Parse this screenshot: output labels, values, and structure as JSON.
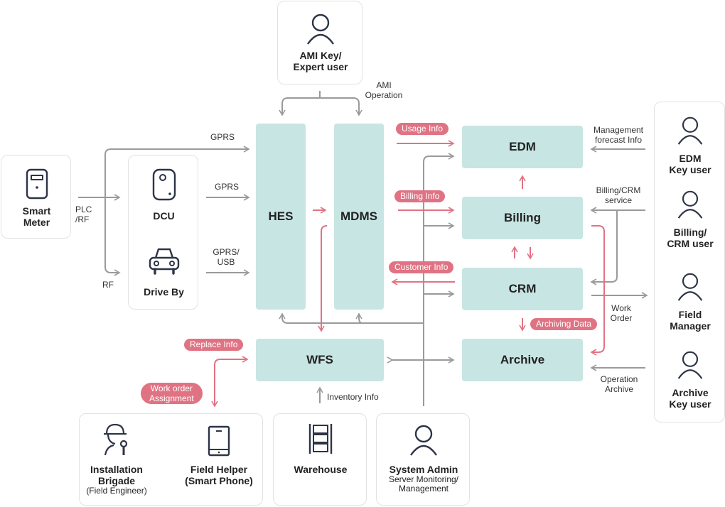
{
  "actors": {
    "ami_user": {
      "line1": "AMI Key/",
      "line2": "Expert user"
    },
    "smart_meter": {
      "line1": "Smart",
      "line2": "Meter"
    },
    "dcu": {
      "label": "DCU"
    },
    "drive_by": {
      "label": "Drive By"
    },
    "edm_user": {
      "line1": "EDM",
      "line2": "Key user"
    },
    "billing_user": {
      "line1": "Billing/",
      "line2": "CRM user"
    },
    "field_manager": {
      "line1": "Field",
      "line2": "Manager"
    },
    "archive_user": {
      "line1": "Archive",
      "line2": "Key user"
    },
    "installation": {
      "line1": "Installation",
      "line2": "Brigade",
      "sub": "(Field Engineer)"
    },
    "field_helper": {
      "line1": "Field Helper",
      "line2": "(Smart Phone)"
    },
    "warehouse": {
      "label": "Warehouse"
    },
    "system_admin": {
      "line1": "System Admin",
      "sub1": "Server Monitoring/",
      "sub2": "Management"
    }
  },
  "systems": {
    "hes": "HES",
    "mdms": "MDMS",
    "edm": "EDM",
    "billing": "Billing",
    "crm": "CRM",
    "archive": "Archive",
    "wfs": "WFS"
  },
  "flow_labels": {
    "ami_operation": {
      "line1": "AMI",
      "line2": "Operation"
    },
    "gprs_top": "GPRS",
    "gprs_dcu": "GPRS",
    "gprs_usb": {
      "line1": "GPRS/",
      "line2": "USB"
    },
    "plc_rf": {
      "line1": "PLC",
      "line2": "/RF"
    },
    "rf": "RF",
    "mgmt_forecast": {
      "line1": "Management",
      "line2": "forecast Info"
    },
    "billing_crm_service": {
      "line1": "Billing/CRM",
      "line2": "service"
    },
    "work_order": {
      "line1": "Work",
      "line2": "Order"
    },
    "operation_archive": {
      "line1": "Operation",
      "line2": "Archive"
    },
    "inventory_info": "Inventory Info"
  },
  "pills": {
    "usage_info": "Usage Info",
    "billing_info": "Billing Info",
    "customer_info": "Customer Info",
    "archiving_data": "Archiving Data",
    "replace_info": "Replace Info",
    "work_order_assignment": {
      "line1": "Work order",
      "line2": "Assignment"
    }
  },
  "colors": {
    "system_fill": "#c7e5e3",
    "accent_pink": "#e07383",
    "wire_gray": "#9a9a9a",
    "icon_navy": "#2d3446"
  }
}
